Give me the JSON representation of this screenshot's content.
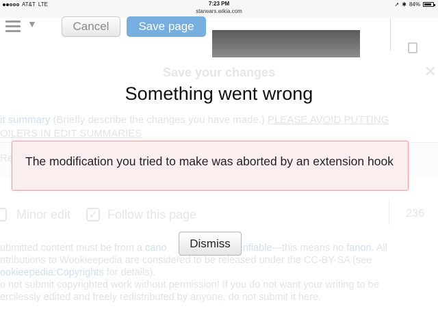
{
  "status_bar": {
    "carrier": "AT&T",
    "network": "LTE",
    "time": "7:23 PM",
    "url": "starwars.wikia.com",
    "battery_percent": "84%",
    "battery_level": 0.84
  },
  "toolbar": {
    "cancel_label": "Cancel",
    "save_label": "Save page"
  },
  "background": {
    "dialog_title": "Save your changes",
    "summary_link": "it summary",
    "summary_hint": " (Briefly describe the changes you have made.) ",
    "summary_warning_1": "PLEASE AVOID PUTTING",
    "summary_warning_2": "OILERS IN EDIT SUMMARIES",
    "summary_box_label": "Re",
    "minor_edit_label": "Minor edit",
    "follow_label": "Follow this page",
    "char_count": "236",
    "legal_1a": "ubmitted content must be from a ",
    "legal_1b": "cano",
    "legal_1c": "verifiable",
    "legal_1d": "—this means no ",
    "legal_1e": "fanon",
    "legal_1f": ". All",
    "legal_2": "ntributions to Wookieepedia are considered to be released under the CC-BY-SA (see",
    "legal_3a": "ookieepedia:Copyrights",
    "legal_3b": " for details).",
    "legal_4": "o not submit copyrighted work without permission! If you do not want your writing to be",
    "legal_5": "ercilessly edited and freely redistributed by anyone, do not submit it here."
  },
  "modal": {
    "title": "Something went wrong",
    "error_message": "The modification you tried to make was aborted by an extension hook",
    "dismiss_label": "Dismiss"
  }
}
